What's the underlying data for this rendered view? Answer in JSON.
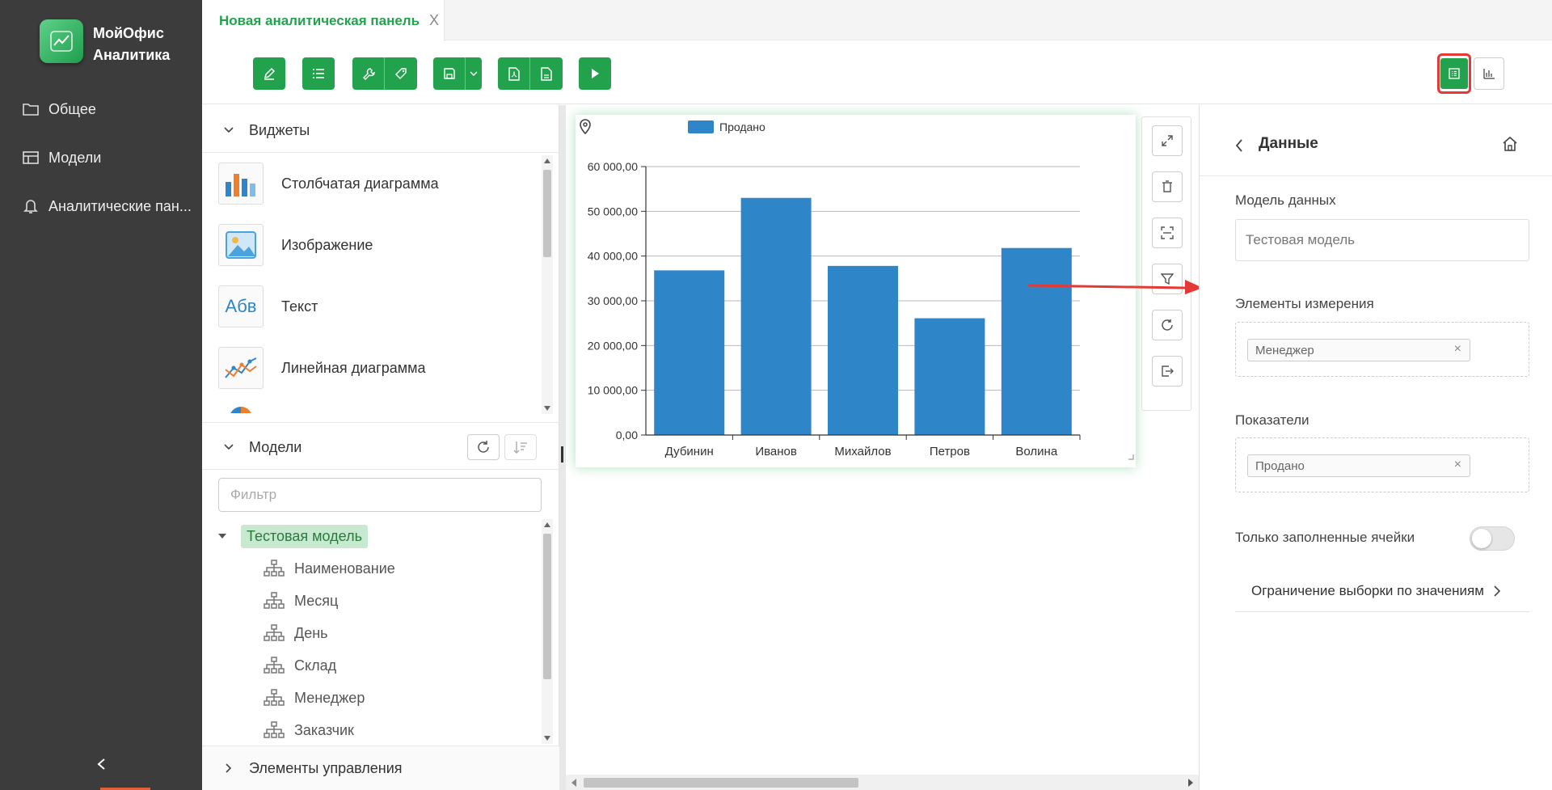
{
  "app": {
    "brand": "МойОфис Аналитика",
    "nav": [
      {
        "label": "Общее",
        "icon": "folder-icon"
      },
      {
        "label": "Модели",
        "icon": "table-icon"
      },
      {
        "label": "Аналитические пан...",
        "icon": "bell-icon"
      }
    ],
    "collapse_icon": "chevron-left-icon"
  },
  "tabs": [
    {
      "label": "Новая аналитическая панель",
      "close": "X"
    }
  ],
  "toolbar": {
    "buttons": [
      "edit-icon",
      "list-icon",
      "wrench-icon",
      "tag-icon",
      "save-icon",
      "chevron-down-icon",
      "pdf-icon",
      "file-icon",
      "play-icon"
    ],
    "view_buttons": [
      "data-panel-icon",
      "chart-settings-icon"
    ]
  },
  "left_panel": {
    "widgets_section": "Виджеты",
    "widgets": [
      {
        "label": "Столбчатая диаграмма",
        "icon": "bar-chart-icon"
      },
      {
        "label": "Изображение",
        "icon": "image-icon"
      },
      {
        "label": "Текст",
        "icon": "text-icon",
        "glyph": "Абв"
      },
      {
        "label": "Линейная диаграмма",
        "icon": "line-chart-icon"
      }
    ],
    "models_section": "Модели",
    "filter_placeholder": "Фильтр",
    "tree": {
      "root": "Тестовая модель",
      "items": [
        "Наименование",
        "Месяц",
        "День",
        "Склад",
        "Менеджер",
        "Заказчик"
      ]
    },
    "controls_section": "Элементы управления"
  },
  "chart_data": {
    "type": "bar",
    "categories": [
      "Дубинин",
      "Иванов",
      "Михайлов",
      "Петров",
      "Волина"
    ],
    "series": [
      {
        "name": "Продано",
        "values": [
          36800,
          53000,
          37800,
          26100,
          41800
        ],
        "color": "#2e86c8"
      }
    ],
    "ylim": [
      0,
      60000
    ],
    "yticks": [
      0,
      10000,
      20000,
      30000,
      40000,
      50000,
      60000
    ],
    "ytick_labels": [
      "0,00",
      "10 000,00",
      "20 000,00",
      "30 000,00",
      "40 000,00",
      "50 000,00",
      "60 000,00"
    ],
    "grid": true,
    "legend": "top-left"
  },
  "widget_tools": [
    "expand-icon",
    "trash-icon",
    "fit-icon",
    "filter-icon",
    "refresh-icon",
    "export-icon"
  ],
  "right_panel": {
    "title": "Данные",
    "model_label": "Модель данных",
    "model_value": "Тестовая модель",
    "dimensions_label": "Элементы измерения",
    "dimensions": [
      "Менеджер"
    ],
    "measures_label": "Показатели",
    "measures": [
      "Продано"
    ],
    "chip_remove": "×",
    "filled_only_label": "Только заполненные ячейки",
    "filled_only": false,
    "limit_link": "Ограничение выборки по значениям"
  },
  "colors": {
    "accent": "#23a24d",
    "sidebar": "#3c3c3c",
    "bar": "#2e86c8",
    "highlight": "#e53935"
  }
}
